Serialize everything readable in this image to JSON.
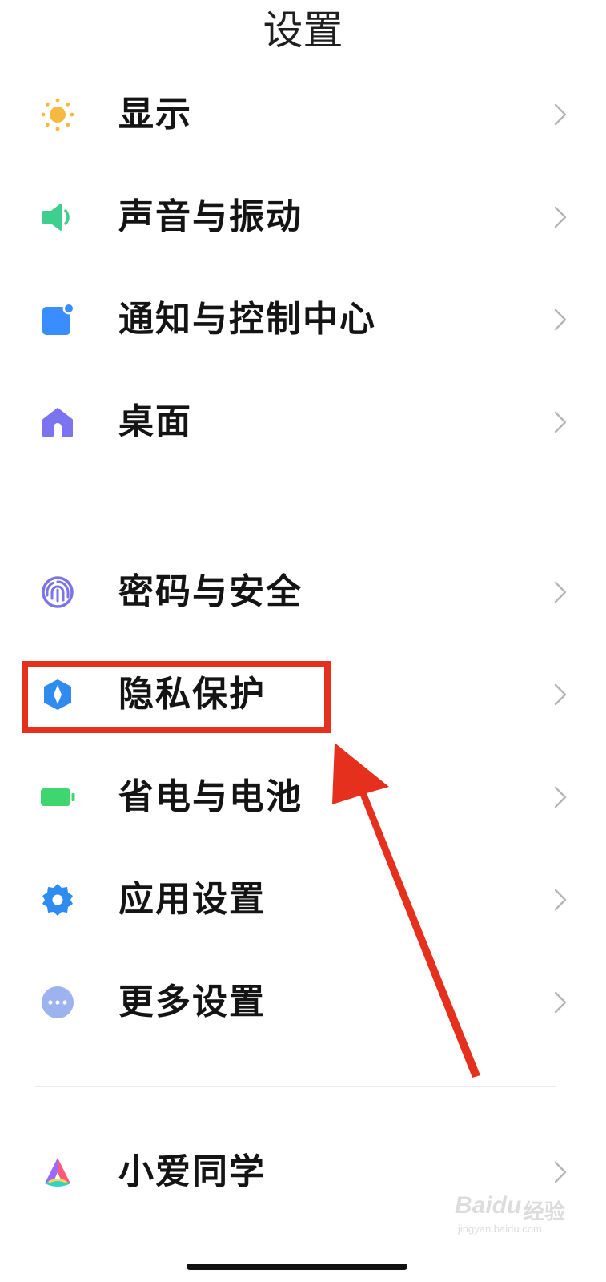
{
  "header": {
    "title": "设置"
  },
  "sections": [
    {
      "items": [
        {
          "label": "显示",
          "icon": "sun-icon",
          "color": "#F5B942"
        },
        {
          "label": "声音与振动",
          "icon": "speaker-icon",
          "color": "#3ECF8E"
        },
        {
          "label": "通知与控制中心",
          "icon": "notification-icon",
          "color": "#3A8DFF"
        },
        {
          "label": "桌面",
          "icon": "home-icon",
          "color": "#7B73F0"
        }
      ]
    },
    {
      "items": [
        {
          "label": "密码与安全",
          "icon": "fingerprint-icon",
          "color": "#7A74E8"
        },
        {
          "label": "隐私保护",
          "icon": "privacy-shield-icon",
          "color": "#2E8BF0"
        },
        {
          "label": "省电与电池",
          "icon": "battery-icon",
          "color": "#3DD66F"
        },
        {
          "label": "应用设置",
          "icon": "gear-icon",
          "color": "#2E8BF0"
        },
        {
          "label": "更多设置",
          "icon": "more-dots-icon",
          "color": "#9DB3F0"
        }
      ]
    },
    {
      "items": [
        {
          "label": "小爱同学",
          "icon": "xiaoai-icon",
          "color": "#FF5A7A"
        }
      ]
    }
  ],
  "annotation": {
    "highlight_color": "#E4301C",
    "highlighted_item": "隐私保护"
  },
  "watermark": {
    "brand": "Baidu",
    "brand_cn": "经验",
    "domain": "jingyan.baidu.com"
  }
}
